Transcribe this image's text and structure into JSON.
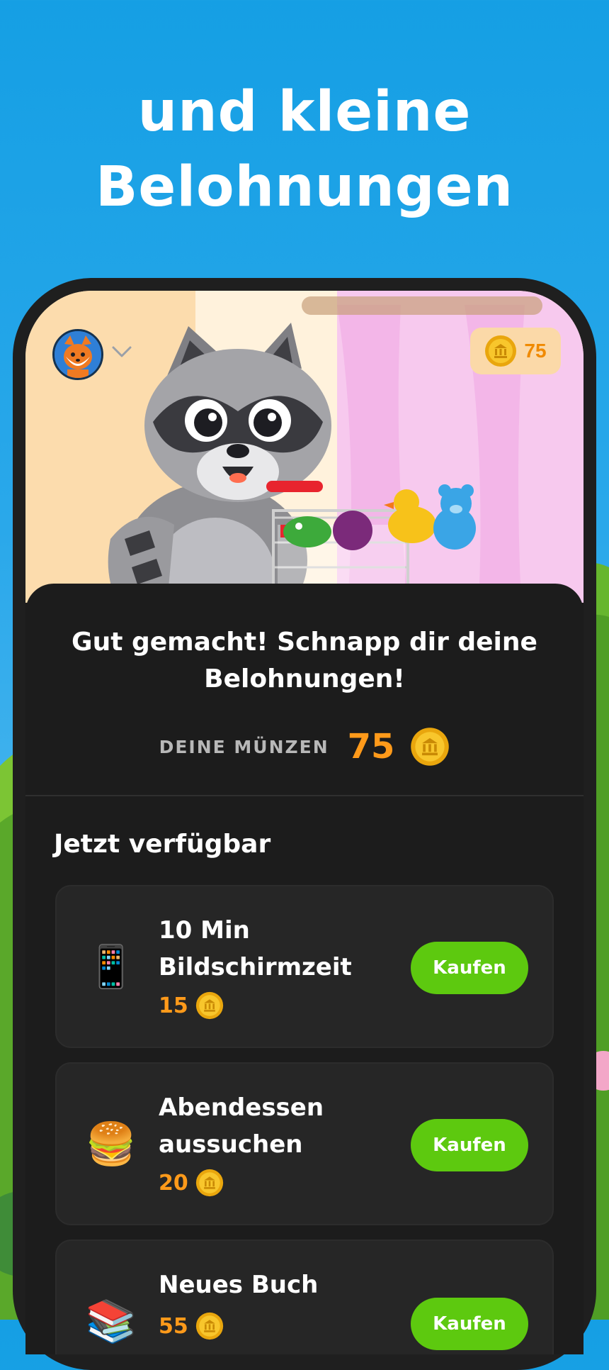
{
  "headline": {
    "line1": "und kleine",
    "line2": "Belohnungen"
  },
  "top_bar": {
    "avatar_icon": "fox-avatar-icon",
    "coin_balance": "75"
  },
  "summary": {
    "title": "Gut gemacht! Schnapp dir deine Belohnungen!",
    "coins_label": "DEINE MÜNZEN",
    "coins_value": "75"
  },
  "section": {
    "title": "Jetzt verfügbar"
  },
  "rewards": [
    {
      "icon": "📱",
      "icon_name": "phone-icon",
      "name": "10 Min Bildschirmzeit",
      "price": "15",
      "button": "Kaufen"
    },
    {
      "icon": "🍔",
      "icon_name": "burger-icon",
      "name": "Abendessen aussuchen",
      "price": "20",
      "button": "Kaufen"
    },
    {
      "icon": "📚",
      "icon_name": "books-icon",
      "name": "Neues Buch",
      "price": "55",
      "button": "Kaufen"
    }
  ],
  "colors": {
    "background": "#159fe4",
    "accent_orange": "#ff9a1a",
    "buy_green": "#5dc90f",
    "sheet": "#1c1c1c",
    "card": "#262626"
  }
}
